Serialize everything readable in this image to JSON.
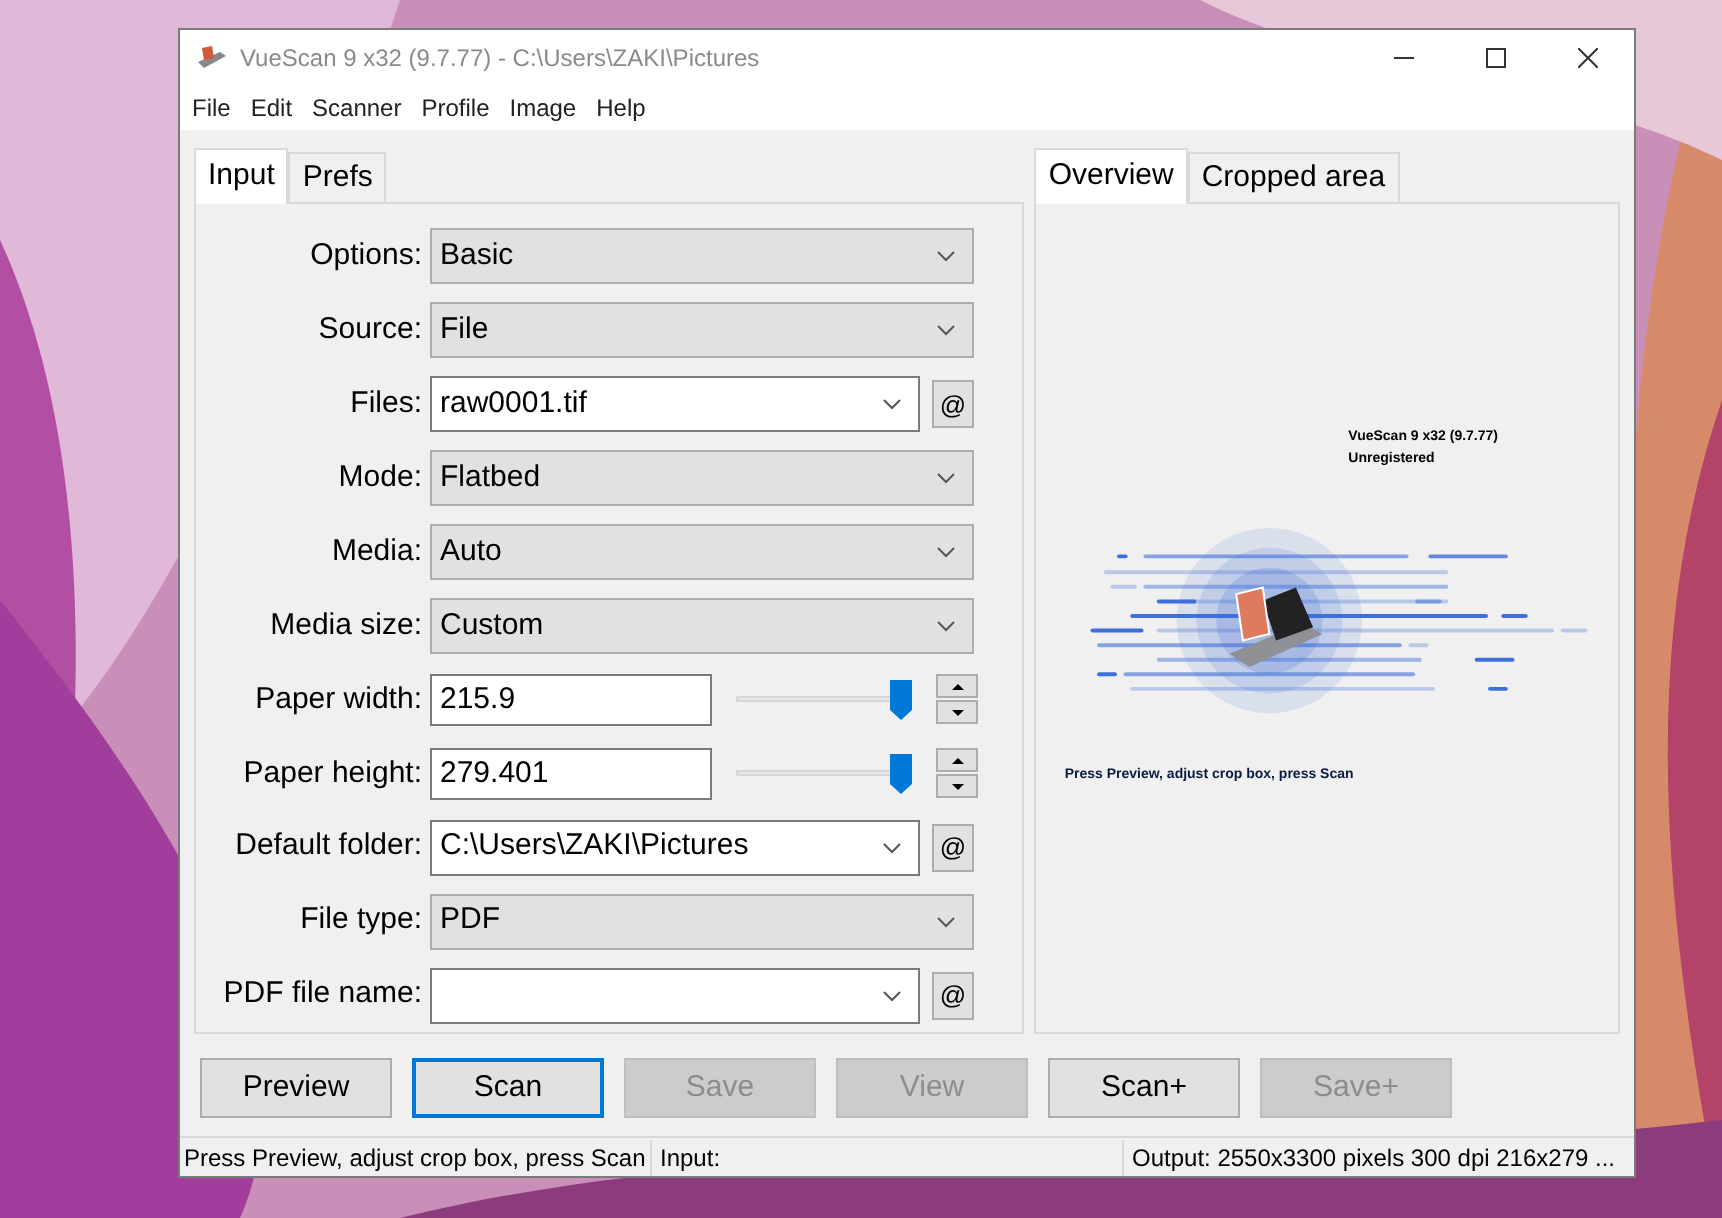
{
  "window": {
    "title": "VueScan 9 x32 (9.7.77) - C:\\Users\\ZAKI\\Pictures"
  },
  "menu": [
    "File",
    "Edit",
    "Scanner",
    "Profile",
    "Image",
    "Help"
  ],
  "left_tabs": [
    {
      "label": "Input",
      "selected": true
    },
    {
      "label": "Prefs",
      "selected": false
    }
  ],
  "fields": [
    {
      "kind": "select",
      "label": "Options:",
      "value": "Basic"
    },
    {
      "kind": "select",
      "label": "Source:",
      "value": "File"
    },
    {
      "kind": "combo",
      "label": "Files:",
      "value": "raw0001.tif",
      "button": "@"
    },
    {
      "kind": "select",
      "label": "Mode:",
      "value": "Flatbed"
    },
    {
      "kind": "select",
      "label": "Media:",
      "value": "Auto"
    },
    {
      "kind": "select",
      "label": "Media size:",
      "value": "Custom"
    },
    {
      "kind": "slider",
      "label": "Paper width:",
      "value": "215.9",
      "level": 0.93
    },
    {
      "kind": "slider",
      "label": "Paper height:",
      "value": "279.401",
      "level": 0.93
    },
    {
      "kind": "combo",
      "label": "Default folder:",
      "value": "C:\\Users\\ZAKI\\Pictures",
      "button": "@"
    },
    {
      "kind": "select",
      "label": "File type:",
      "value": "PDF"
    },
    {
      "kind": "combo",
      "label": "PDF file name:",
      "button": "@"
    }
  ],
  "right_tabs": [
    {
      "label": "Overview",
      "selected": true
    },
    {
      "label": "Cropped area",
      "selected": false
    }
  ],
  "preview": {
    "version": "VueScan 9 x32 (9.7.77)",
    "registration": "Unregistered",
    "hint": "Press Preview, adjust crop box, press Scan"
  },
  "buttons": [
    {
      "label": "Preview",
      "disabled": false,
      "focused": false
    },
    {
      "label": "Scan",
      "disabled": false,
      "focused": true
    },
    {
      "label": "Save",
      "disabled": true,
      "focused": false
    },
    {
      "label": "View",
      "disabled": true,
      "focused": false
    },
    {
      "label": "Scan+",
      "disabled": false,
      "focused": false
    },
    {
      "label": "Save+",
      "disabled": true,
      "focused": false
    }
  ],
  "status_bar": [
    "Press Preview, adjust crop box, press Scan",
    "Input:",
    "Output: 2550x3300 pixels 300 dpi 216x279 ..."
  ]
}
